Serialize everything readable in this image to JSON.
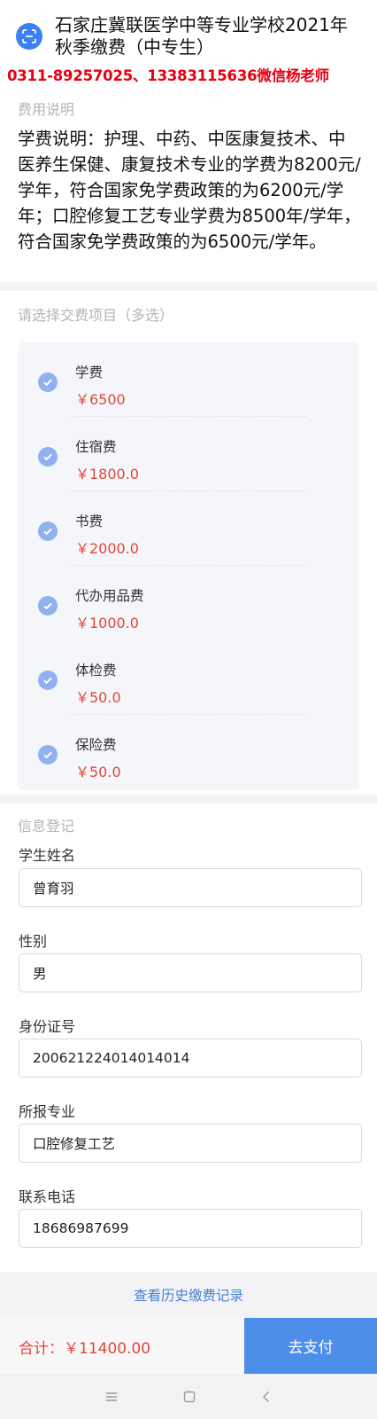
{
  "header": {
    "title": "石家庄冀联医学中等专业学校2021年秋季缴费（中专生）",
    "contact": "0311-89257025、13383115636微信杨老师",
    "scan_icon": "scan-icon",
    "accent": "#3a7ff6"
  },
  "fee_info": {
    "label": "费用说明",
    "text": "学费说明：护理、中药、中医康复技术、中医养生保健、康复技术专业的学费为8200元/学年，符合国家免学费政策的为6200元/学年；口腔修复工艺专业学费为8500年/学年，符合国家免学费政策的为6500元/学年。"
  },
  "items_section": {
    "label": "请选择交费项目（多选）",
    "items": [
      {
        "name": "学费",
        "price": "￥6500",
        "checked": true
      },
      {
        "name": "住宿费",
        "price": "￥1800.0",
        "checked": true
      },
      {
        "name": "书费",
        "price": "￥2000.0",
        "checked": true
      },
      {
        "name": "代办用品费",
        "price": "￥1000.0",
        "checked": true
      },
      {
        "name": "体检费",
        "price": "￥50.0",
        "checked": true
      },
      {
        "name": "保险费",
        "price": "￥50.0",
        "checked": true
      }
    ]
  },
  "registration": {
    "label": "信息登记",
    "fields": [
      {
        "label": "学生姓名",
        "value": "曾育羽"
      },
      {
        "label": "性别",
        "value": "男"
      },
      {
        "label": "身份证号",
        "value": "200621224014014014"
      },
      {
        "label": "所报专业",
        "value": "口腔修复工艺"
      },
      {
        "label": "联系电话",
        "value": "18686987699"
      }
    ]
  },
  "history_link": "查看历史缴费记录",
  "footer": {
    "total_label": "合计：",
    "total_value": "￥11400.00",
    "pay_button": "去支付",
    "price_color": "#e0473c",
    "button_color": "#4d8eea"
  },
  "navbar": {
    "icons": [
      "menu-icon",
      "home-square-icon",
      "back-icon"
    ]
  }
}
